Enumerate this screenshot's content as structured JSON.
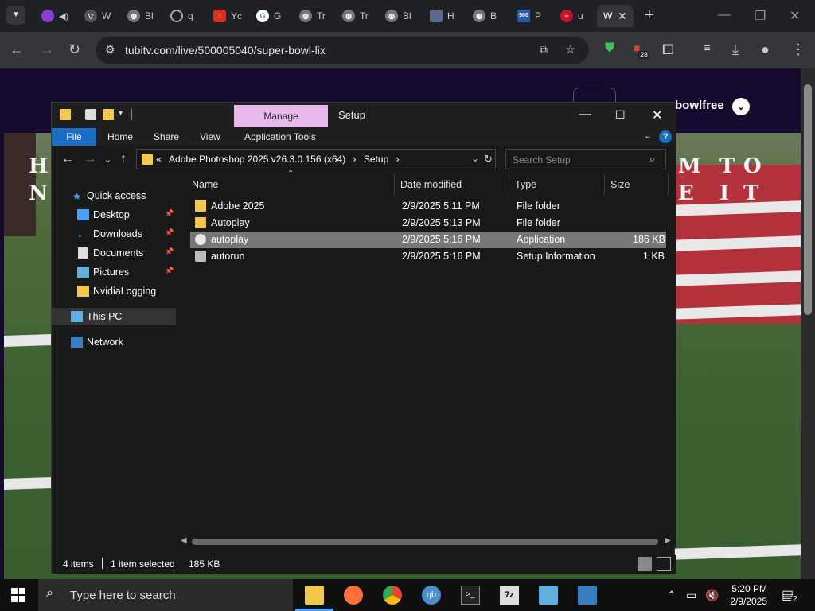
{
  "browser": {
    "tabs": [
      {
        "label": "",
        "color": "#8b3fd9"
      },
      {
        "label": "W",
        "color": "#888888"
      },
      {
        "label": "Bl",
        "color": "#9a9a9a"
      },
      {
        "label": "q",
        "color": "#555555"
      },
      {
        "label": "Yc",
        "color": "#d93025"
      },
      {
        "label": "G",
        "color": "#ffffff"
      },
      {
        "label": "Tr",
        "color": "#9a9a9a"
      },
      {
        "label": "Tr",
        "color": "#9a9a9a"
      },
      {
        "label": "Bl",
        "color": "#9a9a9a"
      },
      {
        "label": "H",
        "color": "#5a6a8a"
      },
      {
        "label": "B",
        "color": "#9a9a9a"
      },
      {
        "label": "P",
        "color": "#2a5caa"
      },
      {
        "label": "u",
        "color": "#c4122f"
      }
    ],
    "active_tab": {
      "label": "W"
    },
    "url": "tubitv.com/live/500005040/super-bowl-lix",
    "extension_badge": "28"
  },
  "site": {
    "brand_text": "bowlfree",
    "field_letters_left": [
      "H",
      "N"
    ],
    "field_letters_right": [
      "M",
      "T",
      "O",
      "E",
      "I",
      "T"
    ]
  },
  "explorer": {
    "ribbon_context_tab": "Manage",
    "window_title": "Setup",
    "ribbon_tabs": {
      "file": "File",
      "home": "Home",
      "share": "Share",
      "view": "View",
      "app_tools": "Application Tools"
    },
    "breadcrumb": {
      "overflow": "«",
      "folder": "Adobe Photoshop 2025 v26.3.0.156 (x64)",
      "sep": "›",
      "current": "Setup"
    },
    "search_placeholder": "Search Setup",
    "nav_pane": [
      {
        "label": "Quick access",
        "icon": "star-icon"
      },
      {
        "label": "Desktop",
        "icon": "desktop-icon",
        "pinned": true
      },
      {
        "label": "Downloads",
        "icon": "download-icon",
        "pinned": true
      },
      {
        "label": "Documents",
        "icon": "document-icon",
        "pinned": true
      },
      {
        "label": "Pictures",
        "icon": "pictures-icon",
        "pinned": true
      },
      {
        "label": "NvidiaLogging",
        "icon": "folder-icon"
      },
      {
        "label": "This PC",
        "icon": "computer-icon",
        "selected": true
      },
      {
        "label": "Network",
        "icon": "network-icon"
      }
    ],
    "columns": {
      "name": "Name",
      "date": "Date modified",
      "type": "Type",
      "size": "Size"
    },
    "files": [
      {
        "name": "Adobe 2025",
        "date": "2/9/2025 5:11 PM",
        "type": "File folder",
        "size": "",
        "icon": "folder-icon"
      },
      {
        "name": "Autoplay",
        "date": "2/9/2025 5:13 PM",
        "type": "File folder",
        "size": "",
        "icon": "folder-icon"
      },
      {
        "name": "autoplay",
        "date": "2/9/2025 5:16 PM",
        "type": "Application",
        "size": "186 KB",
        "icon": "app-icon",
        "selected": true
      },
      {
        "name": "autorun",
        "date": "2/9/2025 5:16 PM",
        "type": "Setup Information",
        "size": "1 KB",
        "icon": "setup-file-icon"
      }
    ],
    "status": {
      "items": "4 items",
      "selected": "1 item selected",
      "size": "185 KB"
    }
  },
  "taskbar": {
    "search_placeholder": "Type here to search",
    "clock_time": "5:20 PM",
    "clock_date": "2/9/2025",
    "notifications": "2"
  }
}
